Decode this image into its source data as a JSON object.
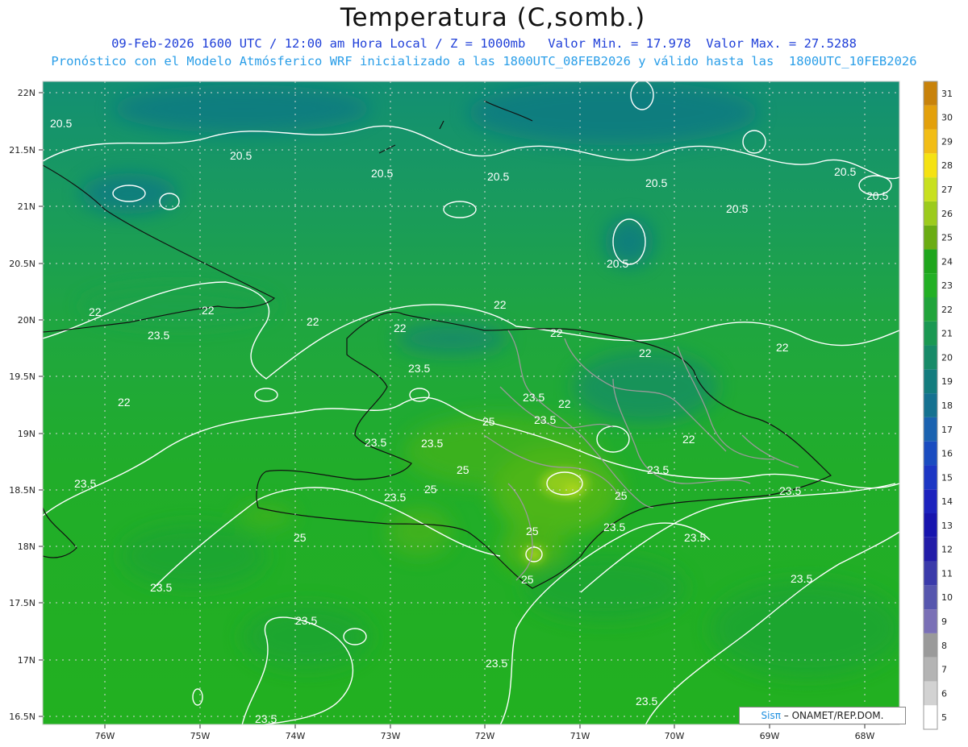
{
  "header": {
    "title": "Temperatura (C,somb.)",
    "subtitle_line1": "09-Feb-2026 1600 UTC / 12:00 am Hora Local / Z = 1000mb   Valor Min. = 17.978  Valor Max. = 27.5288",
    "subtitle_line2": "Pronóstico con el Modelo Atmósferico WRF inicializado a las 1800UTC_08FEB2026 y válido hasta las  1800UTC_10FEB2026"
  },
  "axes": {
    "lat_labels": [
      "22N",
      "21.5N",
      "21N",
      "20.5N",
      "20N",
      "19.5N",
      "19N",
      "18.5N",
      "18N",
      "17.5N",
      "17N",
      "16.5N"
    ],
    "lon_labels": [
      "76W",
      "75W",
      "74W",
      "73W",
      "72W",
      "71W",
      "70W",
      "69W",
      "68W"
    ],
    "lat_range": [
      16.5,
      22
    ],
    "lon_range": [
      -76.6,
      -67.6
    ]
  },
  "colorbar": {
    "levels": [
      "31",
      "30",
      "29",
      "28",
      "27",
      "26",
      "25",
      "24",
      "23",
      "22",
      "21",
      "20",
      "19",
      "18",
      "17",
      "16",
      "15",
      "14",
      "13",
      "12",
      "11",
      "10",
      "9",
      "8",
      "7",
      "6",
      "5"
    ],
    "colors": [
      "#c8820a",
      "#e3a00b",
      "#f2bd15",
      "#f5e212",
      "#c8e01e",
      "#9ccb1c",
      "#6aac12",
      "#1ea61c",
      "#22b024",
      "#20a43a",
      "#1a9852",
      "#178a68",
      "#137c7e",
      "#157190",
      "#1a62b0",
      "#1a4cc0",
      "#1c36c4",
      "#1c22be",
      "#1714ae",
      "#221ca8",
      "#3a3aaa",
      "#5656ae",
      "#7a70b6",
      "#9a9a9a",
      "#b4b4b4",
      "#d2d2d2",
      "#ffffff"
    ]
  },
  "contour_labels": [
    "20.5",
    "22",
    "23.5",
    "25"
  ],
  "credit": {
    "brand": "Sisπ",
    "text": " – ONAMET/REP.DOM."
  }
}
